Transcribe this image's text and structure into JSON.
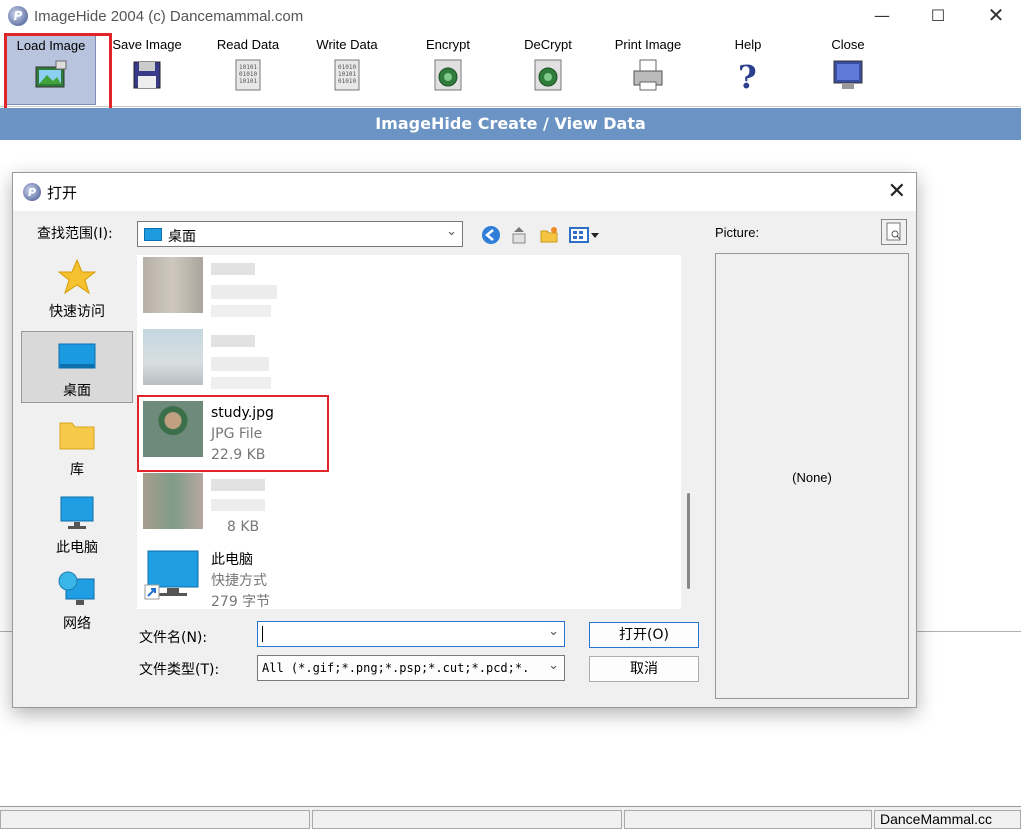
{
  "window": {
    "title": "ImageHide 2004 (c) Dancemammal.com"
  },
  "toolbar": {
    "buttons": [
      {
        "label": "Load Image",
        "icon": "load-image-icon"
      },
      {
        "label": "Save Image",
        "icon": "floppy-disk-icon"
      },
      {
        "label": "Read Data",
        "icon": "binary-document-icon"
      },
      {
        "label": "Write Data",
        "icon": "binary-document-icon"
      },
      {
        "label": "Encrypt",
        "icon": "encrypt-icon"
      },
      {
        "label": "DeCrypt",
        "icon": "decrypt-icon"
      },
      {
        "label": "Print Image",
        "icon": "printer-icon"
      },
      {
        "label": "Help",
        "icon": "help-icon"
      },
      {
        "label": "Close",
        "icon": "monitor-close-icon"
      }
    ]
  },
  "banner": {
    "title": "ImageHide Create / View Data"
  },
  "status": {
    "company": "DanceMammal.cc"
  },
  "dialog": {
    "title": "打开",
    "look_in_label": "查找范围(I):",
    "look_in_value": "桌面",
    "places": [
      {
        "label": "快速访问",
        "icon": "star-icon"
      },
      {
        "label": "桌面",
        "icon": "desktop-icon"
      },
      {
        "label": "库",
        "icon": "folder-icon"
      },
      {
        "label": "此电脑",
        "icon": "computer-icon"
      },
      {
        "label": "网络",
        "icon": "network-icon"
      }
    ],
    "files": [
      {
        "name": "study.jpg",
        "type": "JPG File",
        "size": "22.9 KB"
      },
      {
        "size": "8 KB"
      },
      {
        "name": "此电脑",
        "type": "快捷方式",
        "size": "279 字节"
      }
    ],
    "filename_label": "文件名(N):",
    "filename_value": "",
    "filetype_label": "文件类型(T):",
    "filetype_value": "All (*.gif;*.png;*.psp;*.cut;*.pcd;*.",
    "open_button": "打开(O)",
    "cancel_button": "取消",
    "picture_label": "Picture:",
    "picture_none": "(None)"
  }
}
